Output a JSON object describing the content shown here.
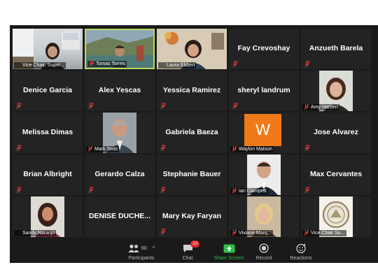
{
  "grid": {
    "row1": {
      "vice_chair_label": "Vice Chair, Super...",
      "tomas_label": "Tomas Torres",
      "laura_label": "Laura Ebbert",
      "fay": "Fay Crevoshay",
      "anzueth": "Anzueth Barela"
    },
    "row2": {
      "denice": "Denice Garcia",
      "alex": "Alex Yescas",
      "yessica": "Yessica Ramirez",
      "sheryl": "sheryl landrum",
      "amy_label": "Amy Harbert"
    },
    "row3": {
      "melissa": "Melissa Dimas",
      "mark_label": "Mark Seits",
      "gabriela": "Gabriela Baeza",
      "waylon_initial": "W",
      "waylon_label": "Waylon Matson",
      "jose": "Jose Alvarez"
    },
    "row4": {
      "brian": "Brian Albright",
      "gerardo": "Gerardo Calza",
      "stephanie": "Stephanie Bauer",
      "ian_label": "Ian Clampett",
      "max": "Max Cervantes"
    },
    "row5": {
      "sandy_label": "Sandy Naranjo",
      "denise": "DENISE  DUCHE...",
      "mary": "Mary Kay Faryan",
      "viviane_label": "Viviane Marq...",
      "vice_chair2_label": "Vice Chair Su..."
    }
  },
  "toolbar": {
    "participants_count": "60",
    "participants_label": "Participants",
    "chat_badge": "10",
    "chat_label": "Chat",
    "share_label": "Share Screen",
    "record_label": "Record",
    "reactions_label": "Reactions"
  },
  "colors": {
    "active_speaker": "#b9d85a",
    "share_green": "#2fbf4a",
    "muted_red": "#e02828",
    "waylon_avatar": "#f07a1a"
  }
}
